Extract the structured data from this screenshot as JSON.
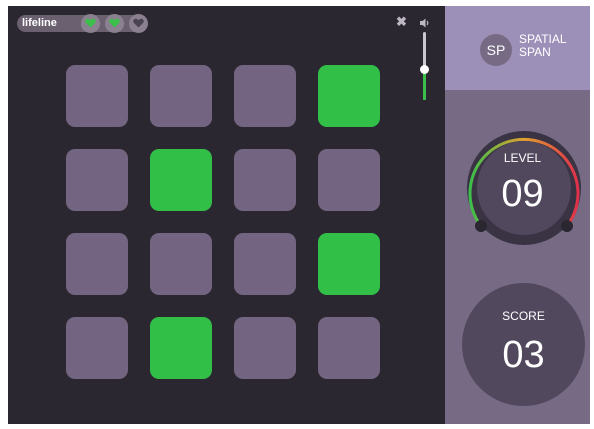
{
  "lifeline": {
    "label": "lifeline",
    "hearts": [
      {
        "state": "full",
        "color": "#3cbf4a",
        "icon": "heart-icon"
      },
      {
        "state": "full",
        "color": "#3cbf4a",
        "icon": "heart-icon"
      },
      {
        "state": "empty",
        "color": "#4a4350",
        "icon": "heart-icon"
      }
    ]
  },
  "controls": {
    "close_icon": "✖",
    "speaker_icon": "speaker-icon",
    "volume_level": 0.45
  },
  "grid": {
    "rows": 4,
    "cols": 4,
    "active_color": "#32bf48",
    "inactive_color": "#736581",
    "cells": [
      [
        false,
        false,
        false,
        true
      ],
      [
        false,
        true,
        false,
        false
      ],
      [
        false,
        false,
        false,
        true
      ],
      [
        false,
        true,
        false,
        false
      ]
    ]
  },
  "game": {
    "logo": "SP",
    "title_line1": "SPATIAL",
    "title_line2": "SPAN"
  },
  "level": {
    "label": "LEVEL",
    "value": "09"
  },
  "score": {
    "label": "SCORE",
    "value": "03"
  },
  "colors": {
    "board_bg": "#2a2730",
    "panel_bg": "#776a84",
    "panel_header_bg": "#9d90b8",
    "gauge_gradient": [
      "#3cbf4a",
      "#e0a030",
      "#e0304a"
    ]
  }
}
